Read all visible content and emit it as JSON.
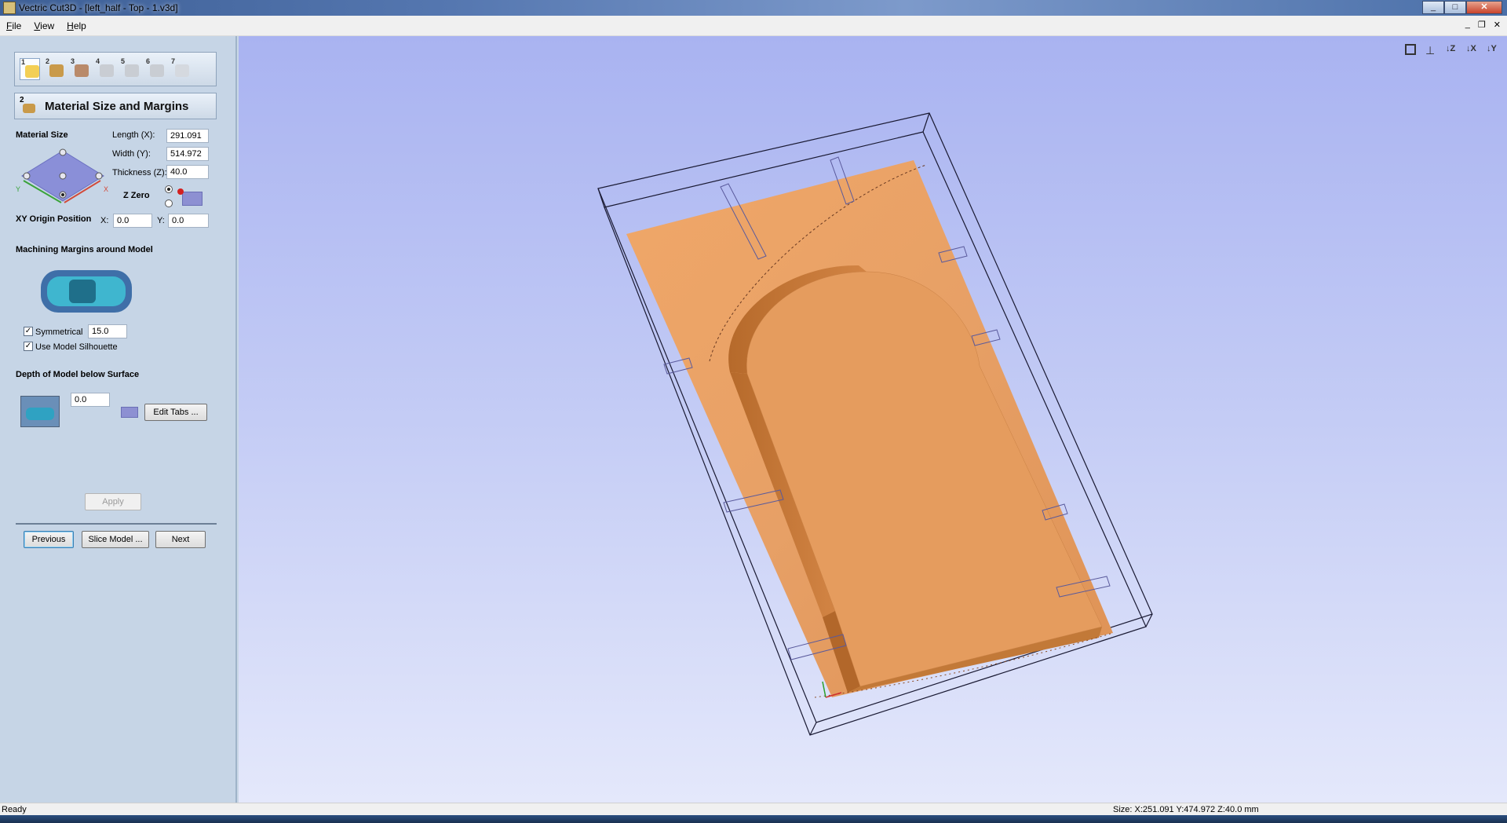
{
  "window": {
    "title": "Vectric Cut3D - [left_half - Top - 1.v3d]"
  },
  "menu": {
    "items": [
      "File",
      "View",
      "Help"
    ]
  },
  "steps": [
    "1",
    "2",
    "3",
    "4",
    "5",
    "6",
    "7"
  ],
  "panel": {
    "step_number": "2",
    "title": "Material Size and Margins",
    "material_size_label": "Material Size",
    "length_label": "Length (X):",
    "length_value": "291.091",
    "width_label": "Width (Y):",
    "width_value": "514.972",
    "thickness_label": "Thickness (Z):",
    "thickness_value": "40.0",
    "z_zero_label": "Z Zero",
    "xy_origin_label": "XY Origin Position",
    "x_label": "X:",
    "x_value": "0.0",
    "y_label": "Y:",
    "y_value": "0.0",
    "margins_label": "Machining Margins around Model",
    "symmetrical_label": "Symmetrical",
    "symmetrical_checked": true,
    "symmetrical_value": "15.0",
    "silhouette_label": "Use Model Silhouette",
    "silhouette_checked": true,
    "depth_label": "Depth of Model below Surface",
    "depth_value": "0.0",
    "edit_tabs_label": "Edit Tabs ...",
    "apply_label": "Apply",
    "previous_label": "Previous",
    "slice_label": "Slice Model ...",
    "next_label": "Next"
  },
  "view_tools": [
    "fit-view-icon",
    "iso-view-icon",
    "z-view-icon",
    "x-view-icon",
    "y-view-icon"
  ],
  "status": {
    "left": "Ready",
    "size": "Size: X:251.091 Y:474.972 Z:40.0 mm"
  },
  "colors": {
    "accent": "#3c7fb1",
    "viewport_top": "#a9b3f1",
    "wood": "#e09a5a"
  }
}
